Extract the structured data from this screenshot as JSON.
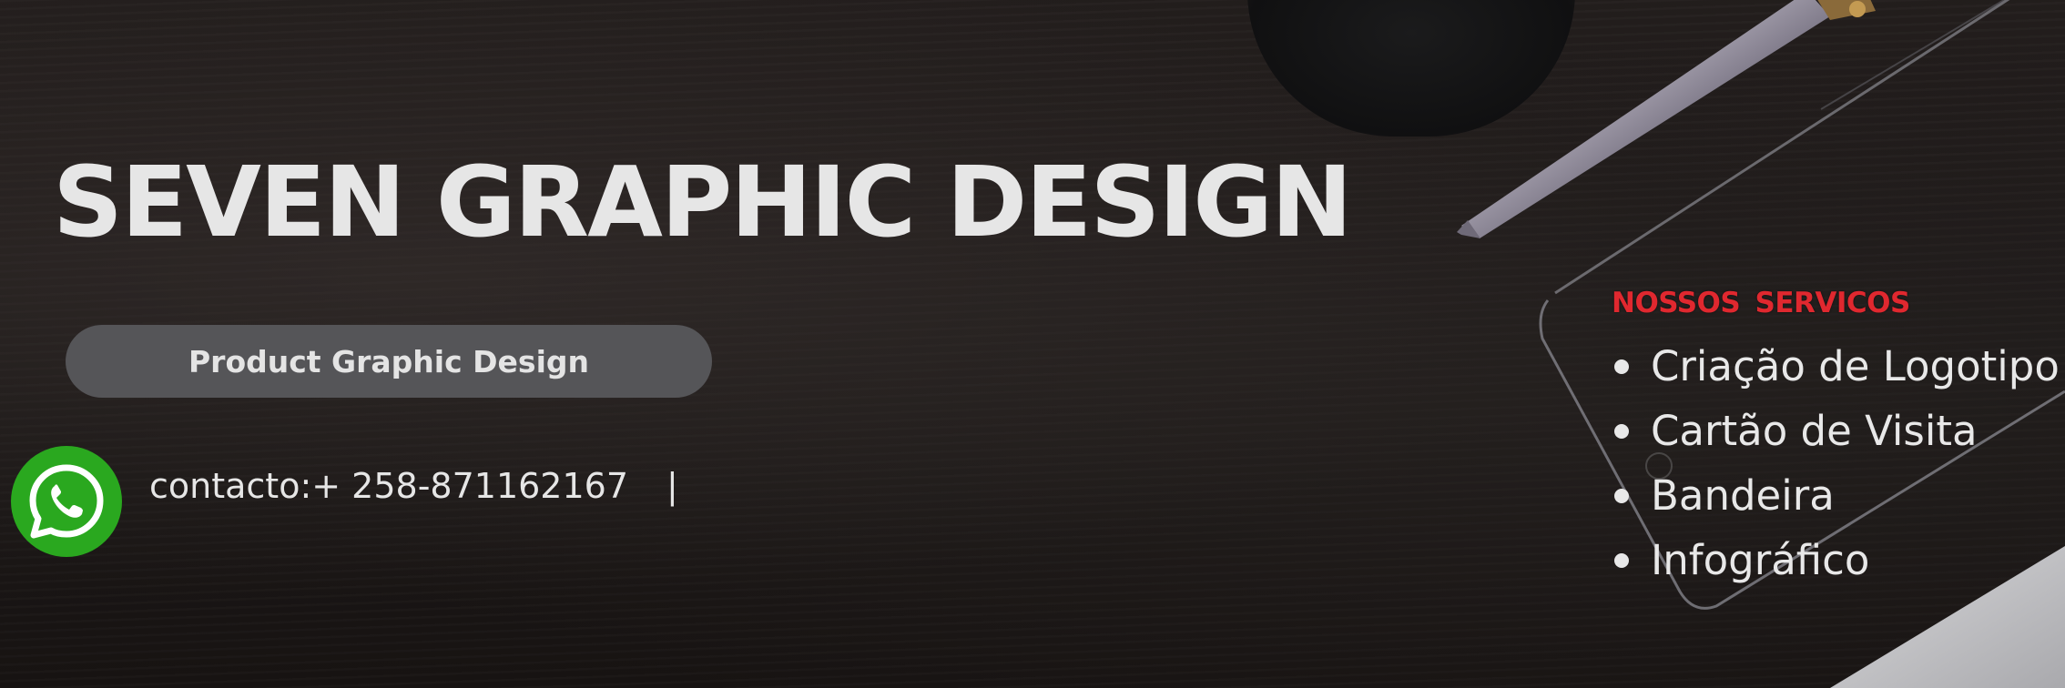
{
  "banner": {
    "title": "SEVEN GRAPHIC DESIGN",
    "button_label": "Product Graphic Design",
    "contact_text": "contacto:+ 258-871162167",
    "contact_separator": "|",
    "contact_icon": "whatsapp-icon"
  },
  "services": {
    "heading": "NOSSOS  SERVICOS",
    "items": [
      {
        "label": "Criação de Logotipo"
      },
      {
        "label": "Cartão de Visita"
      },
      {
        "label": "Bandeira"
      },
      {
        "label": "Infográfico"
      }
    ]
  },
  "colors": {
    "background": "#1d1918",
    "title": "#e6e6e6",
    "button_bg": "#555558",
    "whatsapp_green": "#2aa81f",
    "services_heading": "#e0282f"
  }
}
